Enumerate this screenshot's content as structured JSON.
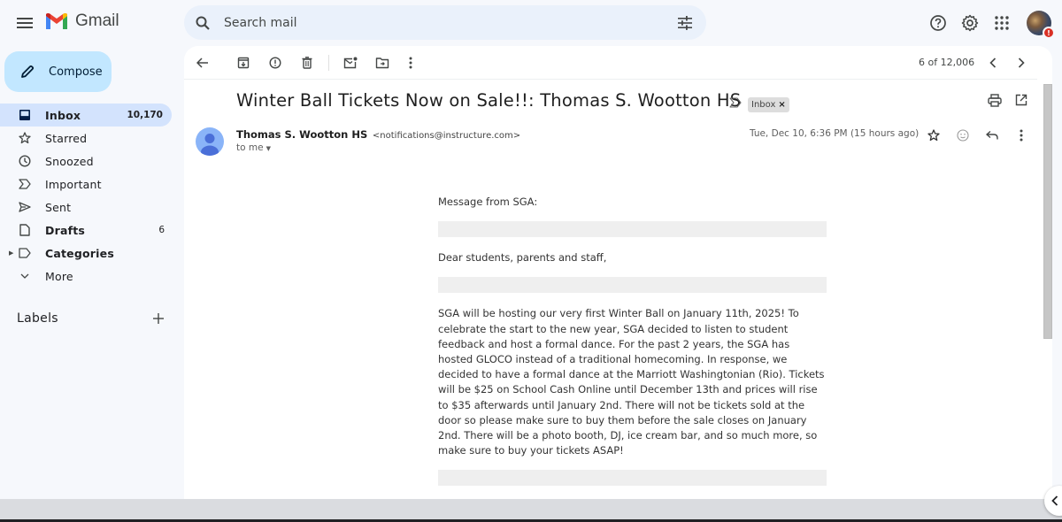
{
  "app": {
    "name": "Gmail",
    "brand_colors": {
      "red": "#ea4335",
      "blue": "#4285f4",
      "green": "#34a853",
      "yellow": "#fbbc04"
    }
  },
  "search": {
    "placeholder": "Search mail",
    "value": ""
  },
  "header_icons": [
    "help-icon",
    "settings-icon",
    "apps-icon",
    "account-avatar"
  ],
  "compose": {
    "label": "Compose"
  },
  "sidebar": {
    "items": [
      {
        "label": "Inbox",
        "count": "10,170",
        "icon": "inbox-icon",
        "active": true,
        "bold": true
      },
      {
        "label": "Starred",
        "count": "",
        "icon": "star-icon",
        "active": false,
        "bold": false
      },
      {
        "label": "Snoozed",
        "count": "",
        "icon": "clock-icon",
        "active": false,
        "bold": false
      },
      {
        "label": "Important",
        "count": "",
        "icon": "important-icon",
        "active": false,
        "bold": false
      },
      {
        "label": "Sent",
        "count": "",
        "icon": "send-icon",
        "active": false,
        "bold": false
      },
      {
        "label": "Drafts",
        "count": "6",
        "icon": "draft-icon",
        "active": false,
        "bold": true
      },
      {
        "label": "Categories",
        "count": "",
        "icon": "label-icon",
        "active": false,
        "bold": true
      },
      {
        "label": "More",
        "count": "",
        "icon": "chevron-down-icon",
        "active": false,
        "bold": false
      }
    ],
    "labels_header": "Labels"
  },
  "toolbar": {
    "actions": [
      "back",
      "archive",
      "report-spam",
      "delete",
      "mark-unread",
      "move-to",
      "more"
    ],
    "pager": "6 of 12,006"
  },
  "email": {
    "subject": "Winter Ball Tickets Now on Sale!!: Thomas S. Wootton HS",
    "label_chip": "Inbox",
    "label_chip_remove": "×",
    "sender_name": "Thomas S. Wootton HS",
    "sender_email": "<notifications@instructure.com>",
    "recipient": "to me",
    "date": "Tue, Dec 10, 6:36 PM (15 hours ago)",
    "body": {
      "line1": "Message from SGA:",
      "greeting": "Dear students, parents and staff,",
      "paragraph": "SGA will be hosting our very first Winter Ball on January 11th, 2025! To celebrate the start to the new year, SGA decided to listen to student feedback and host a formal dance. For the past 2 years, the SGA has hosted GLOCO instead of a traditional homecoming. In response, we decided to have a formal dance at the Marriott Washingtonian (Rio). Tickets will be $25 on School Cash Online until December 13th and prices will rise to $35 afterwards until January 2nd. There will not be tickets sold at the door so please make sure to buy them before the sale closes on January 2nd. There will be a photo booth, DJ, ice cream bar, and so much more, so make sure to buy your tickets ASAP!"
    }
  }
}
